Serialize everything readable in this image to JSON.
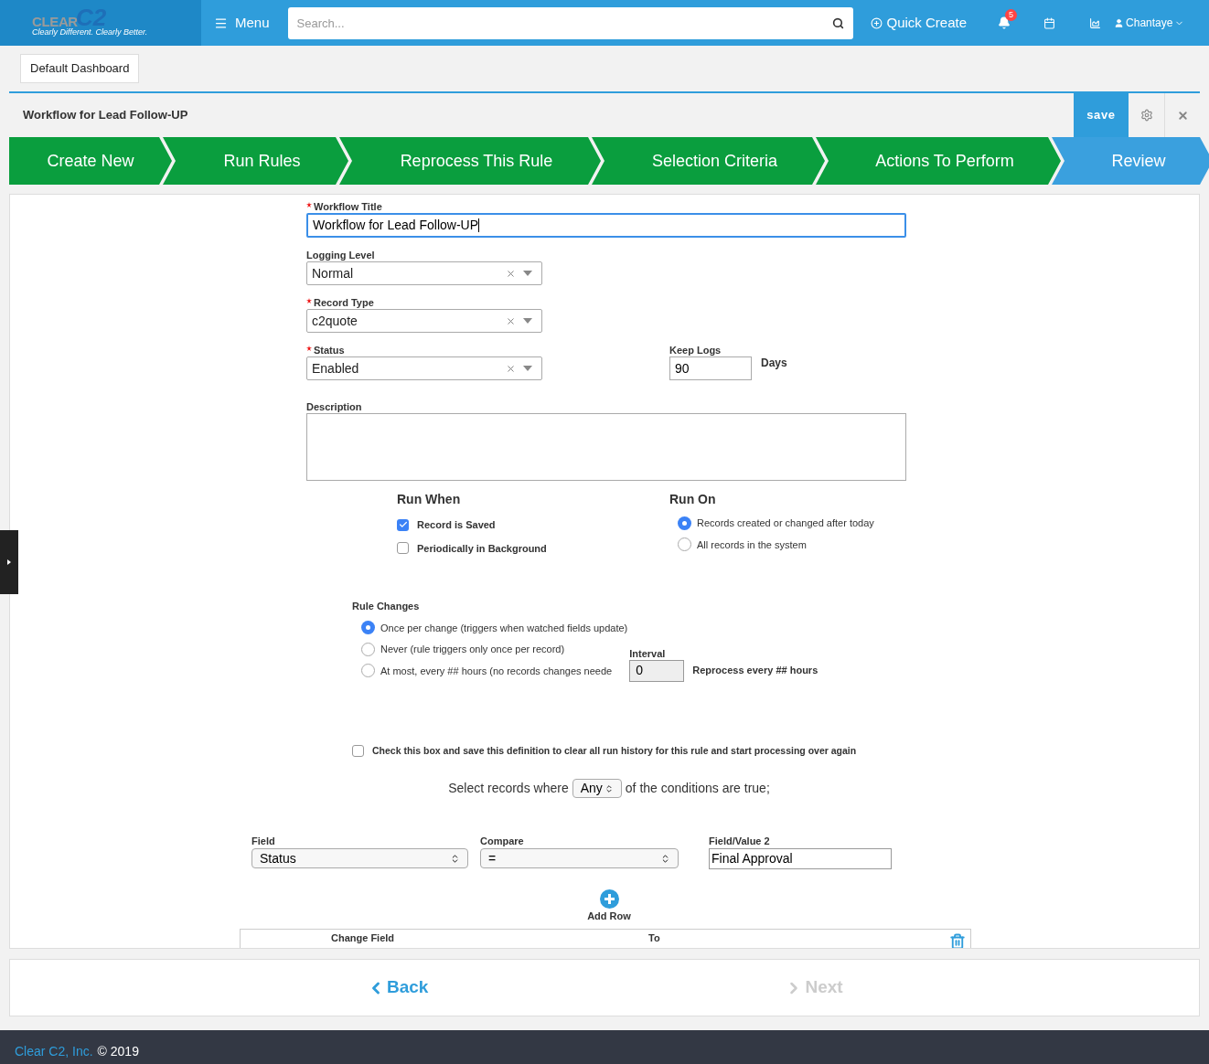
{
  "header": {
    "logo": {
      "word": "CLEAR",
      "mark": "C2",
      "tagline": "Clearly Different. Clearly Better."
    },
    "menu": "Menu",
    "search": {
      "placeholder": "Search..."
    },
    "quick_create": "Quick Create",
    "notifications": "5",
    "user": "Chantaye"
  },
  "dashboard_button": "Default Dashboard",
  "title": "Workflow for Lead Follow-UP",
  "save": "save",
  "steps": [
    {
      "label": "Create New",
      "selected": false
    },
    {
      "label": "Run Rules",
      "selected": false
    },
    {
      "label": "Reprocess This Rule",
      "selected": false
    },
    {
      "label": "Selection Criteria",
      "selected": false
    },
    {
      "label": "Actions To Perform",
      "selected": false
    },
    {
      "label": "Review",
      "selected": true
    }
  ],
  "form": {
    "workflow_title": {
      "label": "Workflow Title",
      "required": true,
      "value": "Workflow for Lead Follow-UP"
    },
    "selects": [
      {
        "label": "Logging Level",
        "required": false,
        "value": "Normal"
      },
      {
        "label": "Record Type",
        "required": true,
        "value": "c2quote"
      },
      {
        "label": "Status",
        "required": true,
        "value": "Enabled"
      }
    ],
    "keep_logs": {
      "label": "Keep Logs",
      "value": "90",
      "unit": "Days"
    },
    "description": {
      "label": "Description"
    },
    "run_when": {
      "heading": "Run When",
      "options": [
        {
          "label": "Record is Saved",
          "checked": true
        },
        {
          "label": "Periodically in Background",
          "checked": false
        }
      ]
    },
    "run_on": {
      "heading": "Run On",
      "options": [
        {
          "label": "Records created or changed after today",
          "selected": true
        },
        {
          "label": "All records in the system",
          "selected": false
        }
      ]
    },
    "rule_changes": {
      "heading": "Rule Changes",
      "options": [
        {
          "label": "Once per change (triggers when watched fields update)",
          "selected": true
        },
        {
          "label": "Never (rule triggers only once per record)",
          "selected": false
        },
        {
          "label": "At most, every ## hours (no records changes neede",
          "selected": false
        }
      ],
      "interval": {
        "label": "Interval",
        "value": "0"
      },
      "reprocess": "Reprocess every ## hours"
    },
    "reset_history": {
      "label": "Check this box and save this definition to clear all run history for this rule and start processing over again",
      "checked": false
    },
    "conditions": {
      "prefix": "Select records where",
      "match": "Any",
      "suffix": "of the conditions are true;",
      "columns": [
        "Field",
        "Compare",
        "Field/Value 2"
      ],
      "row": {
        "field": "Status",
        "compare": "=",
        "value": "Final Approval"
      }
    },
    "add_row": "Add Row",
    "actions_columns": [
      "Change Field",
      "To"
    ]
  },
  "nav": {
    "back": {
      "label": "Back",
      "disabled": false
    },
    "next": {
      "label": "Next",
      "disabled": true
    }
  },
  "footer": {
    "company": "Clear C2, Inc.",
    "copyright": "© 2019"
  }
}
